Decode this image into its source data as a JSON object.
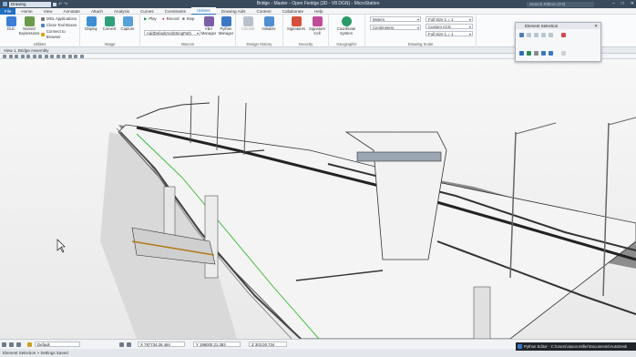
{
  "titlebar": {
    "workspace": "Drawing",
    "title": "Bridge - Master - Open Fieldgs (3D - V8 DGN) - MicroStation",
    "search_placeholder": "Search Ribbon (F4)",
    "controls": [
      "–",
      "□",
      "✕"
    ]
  },
  "tabs": [
    "File",
    "Home",
    "View",
    "Annotate",
    "Attach",
    "Analysis",
    "Curves",
    "Constraints",
    "Utilities",
    "Drawing Aids",
    "Content",
    "Collaborate",
    "Help"
  ],
  "active_tab": "Utilities",
  "ribbon": {
    "groups": [
      {
        "label": "Utilities"
      },
      {
        "label": "Image"
      },
      {
        "label": "Macros"
      },
      {
        "label": "Design History"
      },
      {
        "label": "Security"
      },
      {
        "label": "Geographic"
      },
      {
        "label": "Drawing Scale"
      }
    ],
    "utilities": {
      "big": [
        "DLE",
        "Named Expressions"
      ],
      "small": [
        "MDL Applications",
        "Close Tool Boxes",
        "Connect to Browser"
      ]
    },
    "image": {
      "big": [
        "Display",
        "Convert",
        "Capture"
      ]
    },
    "macros": {
      "small": [
        "Play",
        "Record",
        "Stop"
      ],
      "combo": "AddDefaultAndStringPath",
      "big": [
        "VBA Manager",
        "Python Manager"
      ]
    },
    "design_history": {
      "big": [
        "Commit",
        "Initialize"
      ]
    },
    "security": {
      "big": [
        "Signatures",
        "Signature Cell"
      ]
    },
    "geographic": {
      "big": [
        "Coordinate System"
      ]
    },
    "drawing_scale": {
      "combos": [
        "Meters",
        "Centimeters",
        "Full Size 1 = 1",
        "Custom ACS",
        "Full Size 1 = 1"
      ]
    }
  },
  "view": {
    "title": "View 1, Bridge Assembly"
  },
  "element_selection": {
    "title": "Element Selection",
    "close": "✕"
  },
  "statusbar": {
    "level": "Default",
    "coord_x": "X 787734.26.464",
    "coord_y": "Y 196000.21.383",
    "coord_z": "Z 303.00.734"
  },
  "message": "Element Selection > Settings Saved",
  "toast": "Python Editor - C:\\Users\\Jason.Miller\\Documents\\AutoDesk",
  "colors": {
    "accent": "#1f6fc1",
    "titlebar": "#3a4b5e",
    "alignment": "#2eb82e"
  }
}
